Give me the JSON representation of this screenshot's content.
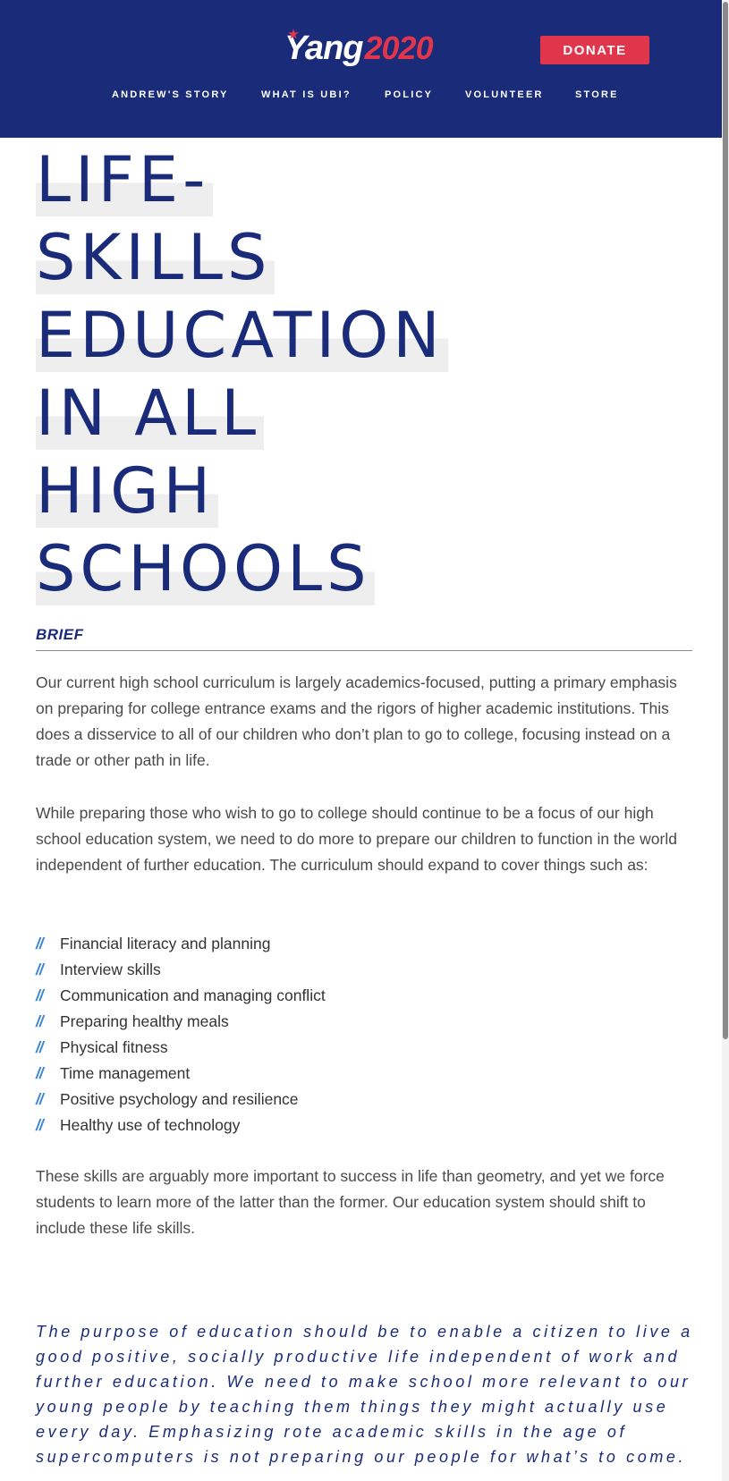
{
  "header": {
    "logo": {
      "name": "Yang",
      "year": "2020"
    },
    "donate_label": "DONATE",
    "nav": [
      {
        "label": "ANDREW'S STORY"
      },
      {
        "label": "WHAT IS UBI?"
      },
      {
        "label": "POLICY"
      },
      {
        "label": "VOLUNTEER"
      },
      {
        "label": "STORE"
      }
    ]
  },
  "article": {
    "title_lines": [
      "LIFE-",
      "SKILLS",
      "EDUCATION",
      "IN ALL",
      "HIGH",
      "SCHOOLS"
    ],
    "section_label": "BRIEF",
    "paragraphs": [
      "Our current high school curriculum is largely academics-focused, putting a primary emphasis on preparing for college entrance exams and the rigors of higher academic institutions. This does a disservice to all of our children who don’t plan to go to college, focusing instead on a trade or other path in life.",
      "While preparing those who wish to go to college should continue to be a focus of our high school education system, we need to do more to prepare our children to function in the world independent of further education. The curriculum should expand to cover things such as:",
      "These skills are arguably more important to success in life than geometry, and yet we force students to learn more of the latter than the former. Our education system should shift to include these life skills."
    ],
    "list_marker": "//",
    "skills": [
      "Financial literacy and planning",
      "Interview skills",
      "Communication and managing conflict",
      "Preparing healthy meals",
      "Physical fitness",
      "Time management",
      "Positive psychology and resilience",
      "Healthy use of technology"
    ],
    "quote": "The purpose of education should be to enable a citizen to live a good positive, socially productive life independent of work and further education. We need to make school more relevant to our young people by teaching them things they might actually use every day. Emphasizing rote academic skills in the age of supercomputers is not preparing our people for what’s to come."
  },
  "colors": {
    "navy": "#1a2b7a",
    "red": "#e0354a",
    "list_marker_blue": "#3e86d6",
    "body_text": "#4a4a4a"
  },
  "icons": {
    "logo_mark": "star-icon"
  }
}
